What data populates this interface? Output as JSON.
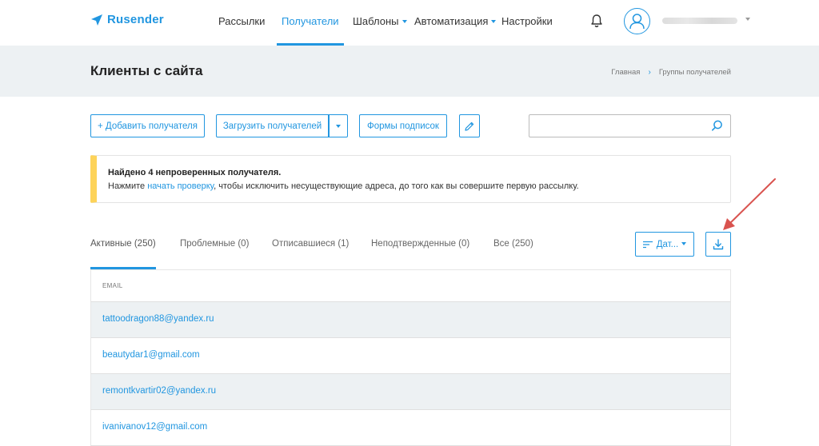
{
  "brand": {
    "name": "Rusender"
  },
  "nav": {
    "items": [
      {
        "label": "Рассылки"
      },
      {
        "label": "Получатели"
      },
      {
        "label": "Шаблоны"
      },
      {
        "label": "Автоматизация"
      },
      {
        "label": "Настройки"
      }
    ],
    "active": "Получатели"
  },
  "header": {
    "title": "Клиенты с сайта",
    "breadcrumbs": [
      "Главная",
      "Группы получателей"
    ]
  },
  "toolbar": {
    "add_label": "+ Добавить получателя",
    "upload_label": "Загрузить получателей",
    "forms_label": "Формы подписок",
    "search_placeholder": ""
  },
  "notice": {
    "title": "Найдено 4 непроверенных получателя.",
    "text_before": "Нажмите ",
    "link": "начать проверку",
    "text_after": ", чтобы исключить несуществующие адреса, до того как вы совершите первую рассылку."
  },
  "tabs": [
    {
      "label": "Активные (250)"
    },
    {
      "label": "Проблемные (0)"
    },
    {
      "label": "Отписавшиеся (1)"
    },
    {
      "label": "Неподтвержденные (0)"
    },
    {
      "label": "Все (250)"
    }
  ],
  "sort": {
    "label": "Дат..."
  },
  "table": {
    "column": "EMAIL",
    "rows": [
      "tattoodragon88@yandex.ru",
      "beautydar1@gmail.com",
      "remontkvartir02@yandex.ru",
      "ivanivanov12@gmail.com"
    ]
  },
  "colors": {
    "accent": "#2196e0",
    "notice_bar": "#fdd35a",
    "band": "#edf1f3",
    "annotation": "#d9534f"
  }
}
